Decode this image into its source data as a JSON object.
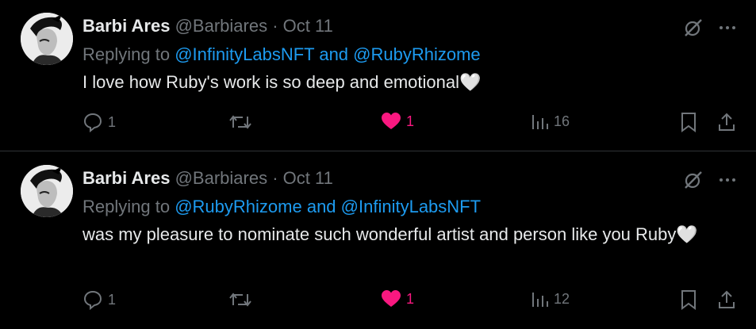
{
  "tweets": [
    {
      "display_name": "Barbi Ares",
      "handle": "@Barbiares",
      "separator": "·",
      "date": "Oct 11",
      "replying_prefix": "Replying to",
      "mention_1": "@InfinityLabsNFT",
      "conjunction": "and",
      "mention_2": "@RubyRhizome",
      "text": "I love how Ruby's work is so deep and emotional🤍",
      "replies": "1",
      "likes": "1",
      "views": "16"
    },
    {
      "display_name": "Barbi Ares",
      "handle": "@Barbiares",
      "separator": "·",
      "date": "Oct 11",
      "replying_prefix": "Replying to",
      "mention_1": "@RubyRhizome",
      "conjunction": "and",
      "mention_2": "@InfinityLabsNFT",
      "text": "was my pleasure to nominate such wonderful artist and person like you Ruby🤍",
      "replies": "1",
      "likes": "1",
      "views": "12"
    }
  ],
  "icons": {
    "grok": "grok-slash-icon",
    "more": "more-dots-icon",
    "reply": "reply-bubble-icon",
    "retweet": "retweet-icon",
    "like": "heart-filled-icon",
    "views": "views-bars-icon",
    "bookmark": "bookmark-icon",
    "share": "share-upload-icon"
  },
  "colors": {
    "background": "#000000",
    "text": "#e7e9ea",
    "muted": "#71767b",
    "mention": "#1d9bf0",
    "like": "#f91880"
  }
}
